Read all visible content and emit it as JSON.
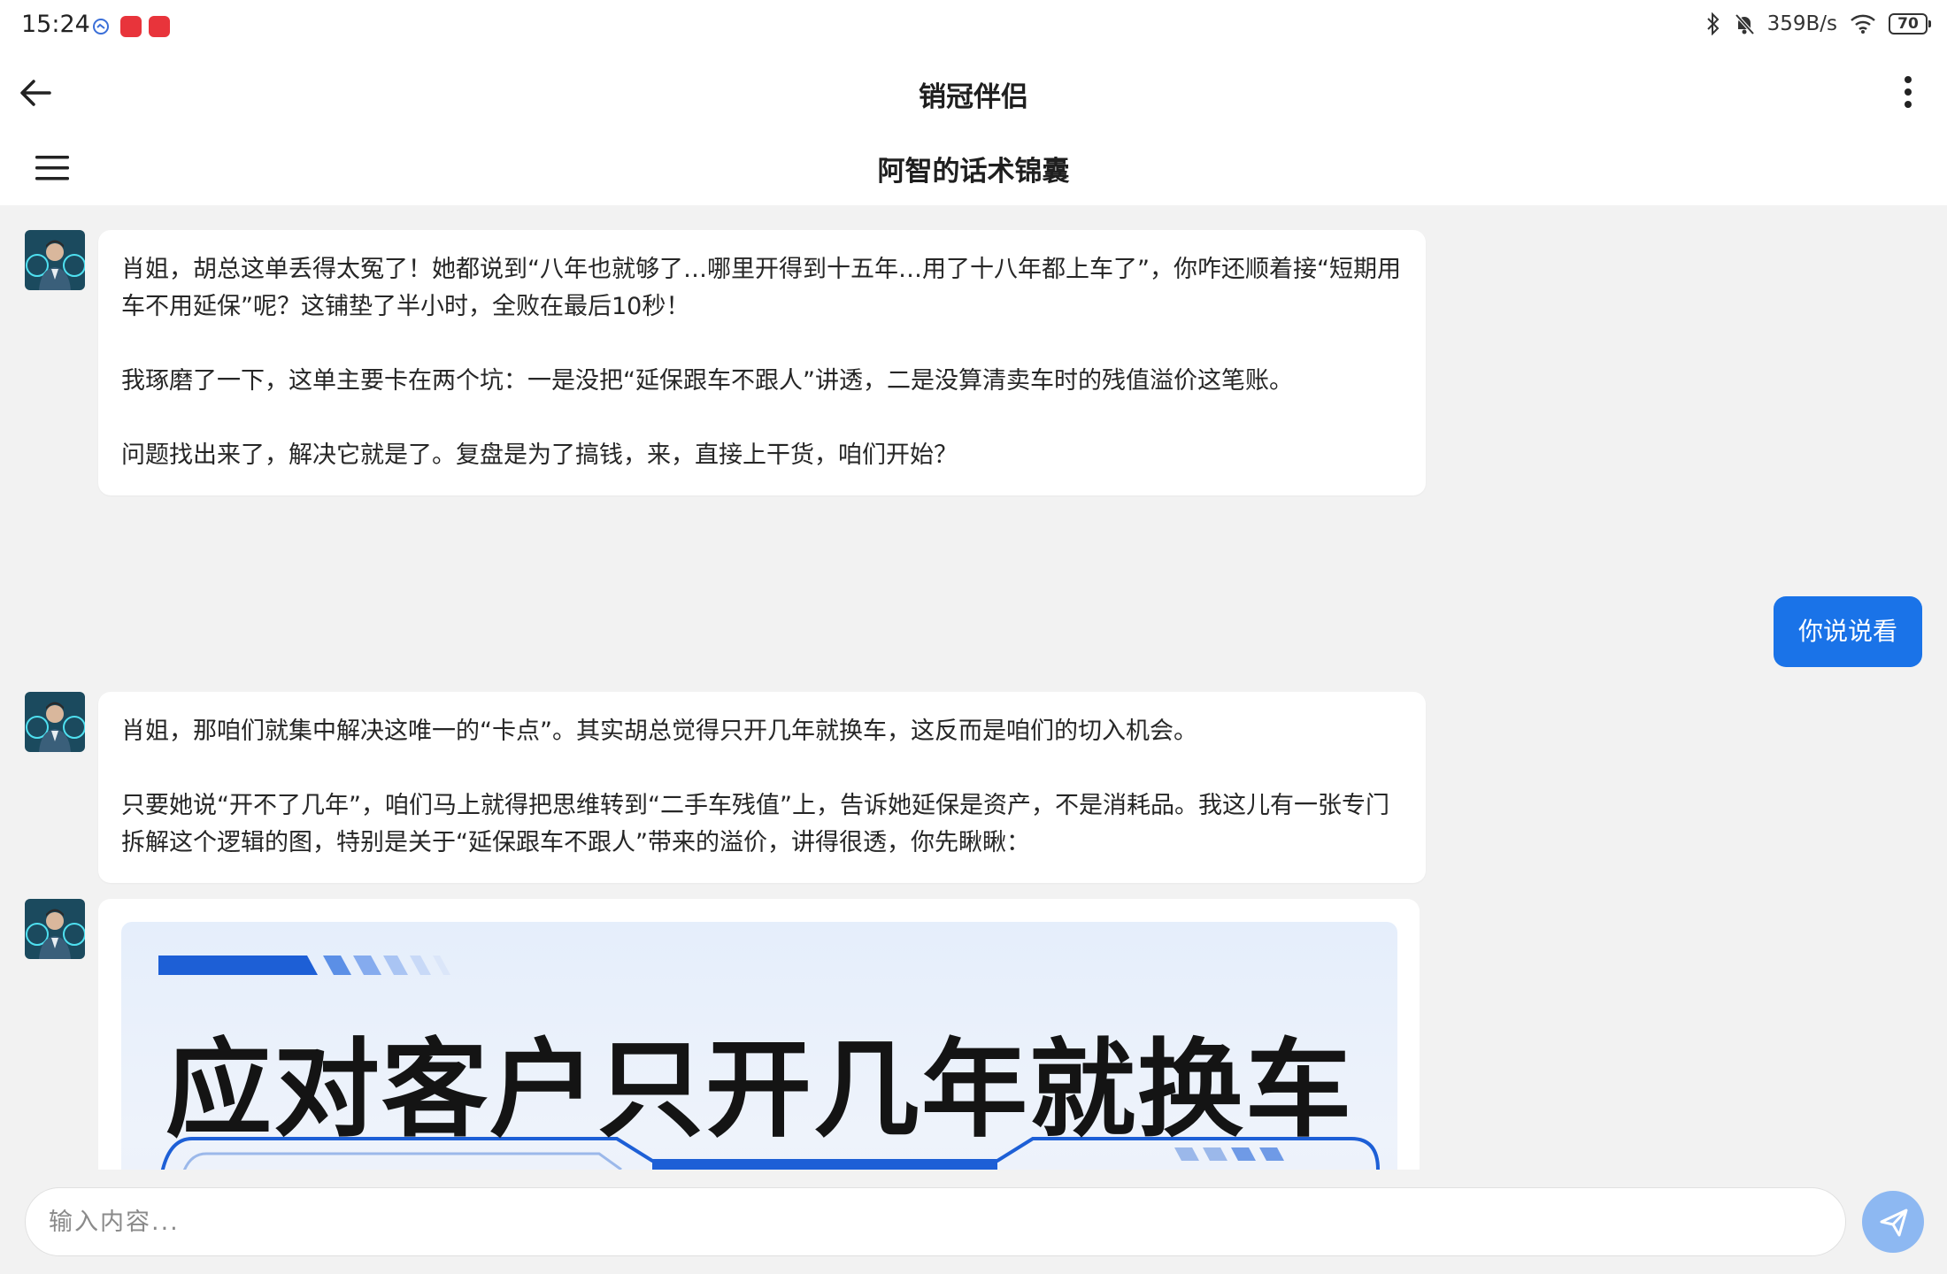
{
  "status_bar": {
    "time": "15:24",
    "net_speed": "359B/s",
    "battery": "70"
  },
  "header": {
    "title": "销冠伴侣",
    "subtitle": "阿智的话术锦囊"
  },
  "messages": {
    "m1": {
      "p1": "肖姐，胡总这单丢得太冤了！她都说到“八年也就够了…哪里开得到十五年…用了十八年都上车了”，你咋还顺着接“短期用车不用延保”呢？这铺垫了半小时，全败在最后10秒！",
      "p2": "我琢磨了一下，这单主要卡在两个坑：一是没把“延保跟车不跟人”讲透，二是没算清卖车时的残值溢价这笔账。",
      "p3": "问题找出来了，解决它就是了。复盘是为了搞钱，来，直接上干货，咱们开始？"
    },
    "m2": {
      "text": "你说说看"
    },
    "m3": {
      "p1": "肖姐，那咱们就集中解决这唯一的“卡点”。其实胡总觉得只开几年就换车，这反而是咱们的切入机会。",
      "p2": "只要她说“开不了几年”，咱们马上就得把思维转到“二手车残值”上，告诉她延保是资产，不是消耗品。我这儿有一张专门拆解这个逻辑的图，特别是关于“延保跟车不跟人”带来的溢价，讲得很透，你先瞅瞅："
    },
    "m4": {
      "image_title": "应对客户只开几年就换车"
    }
  },
  "input": {
    "placeholder": "输入内容..."
  },
  "colors": {
    "accent": "#1a73e8",
    "send": "#8db8f2",
    "background": "#f2f2f2"
  }
}
